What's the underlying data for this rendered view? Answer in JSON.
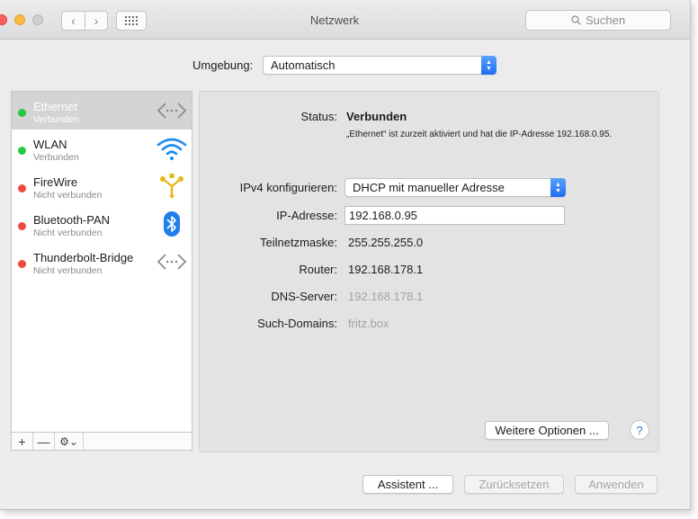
{
  "window": {
    "title": "Netzwerk",
    "search_placeholder": "Suchen"
  },
  "location": {
    "label": "Umgebung:",
    "value": "Automatisch"
  },
  "services": [
    {
      "name": "Ethernet",
      "status": "Verbunden",
      "status_color": "#28c840",
      "selected": true,
      "icon": "ethernet-icon"
    },
    {
      "name": "WLAN",
      "status": "Verbunden",
      "status_color": "#28c840",
      "selected": false,
      "icon": "wifi-icon"
    },
    {
      "name": "FireWire",
      "status": "Nicht verbunden",
      "status_color": "#ee4b3e",
      "selected": false,
      "icon": "firewire-icon"
    },
    {
      "name": "Bluetooth-PAN",
      "status": "Nicht verbunden",
      "status_color": "#ee4b3e",
      "selected": false,
      "icon": "bluetooth-icon"
    },
    {
      "name": "Thunderbolt-Bridge",
      "status": "Nicht verbunden",
      "status_color": "#ee4b3e",
      "selected": false,
      "icon": "thunderbolt-bridge-icon"
    }
  ],
  "sidebar_controls": {
    "add": "+",
    "remove": "—",
    "actions": "⚙⌄"
  },
  "detail": {
    "status_label": "Status:",
    "status_value": "Verbunden",
    "status_desc": "„Ethernet“ ist zurzeit aktiviert und hat die IP-Adresse 192.168.0.95.",
    "ipv4_label": "IPv4 konfigurieren:",
    "ipv4_value": "DHCP mit manueller Adresse",
    "ip_label": "IP-Adresse:",
    "ip_value": "192.168.0.95",
    "subnet_label": "Teilnetzmaske:",
    "subnet_value": "255.255.255.0",
    "router_label": "Router:",
    "router_value": "192.168.178.1",
    "dns_label": "DNS-Server:",
    "dns_value": "192.168.178.1",
    "search_domains_label": "Such-Domains:",
    "search_domains_value": "fritz.box",
    "advanced_button": "Weitere Optionen ...",
    "help": "?"
  },
  "footer": {
    "assistant": "Assistent ...",
    "revert": "Zurücksetzen",
    "apply": "Anwenden"
  },
  "colors": {
    "accent": "#1f6ef2",
    "connected": "#28c840",
    "disconnected": "#ee4b3e"
  }
}
